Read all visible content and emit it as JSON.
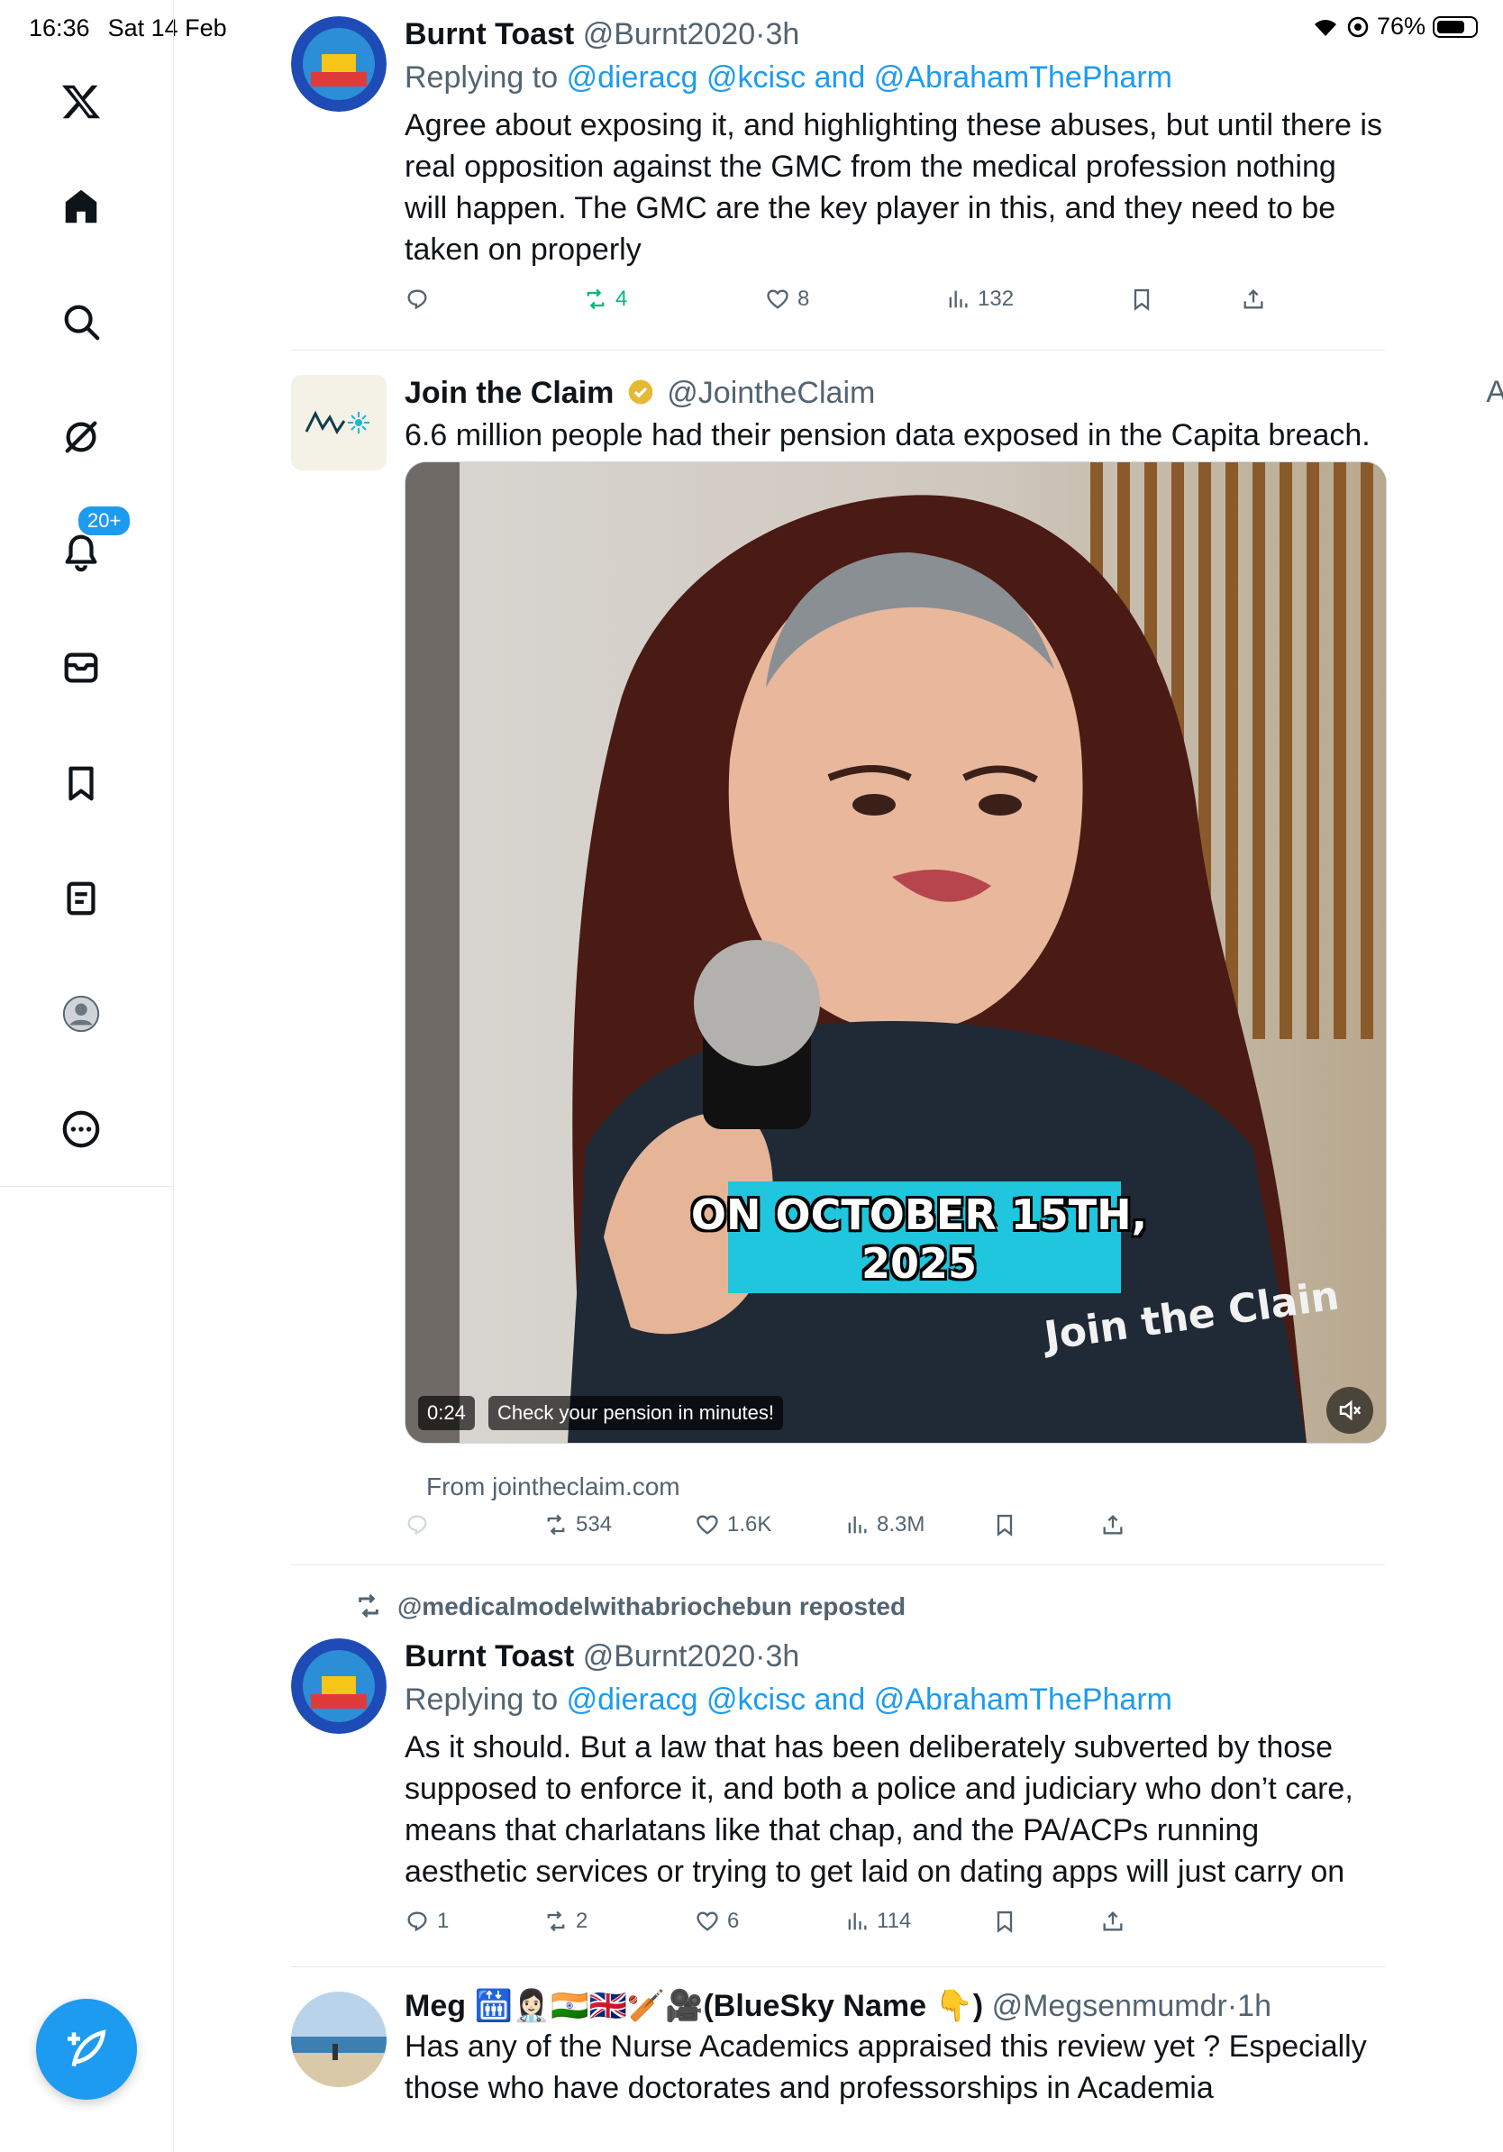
{
  "status_bar": {
    "time": "16:36",
    "date": "Sat 14 Feb",
    "battery": "76%",
    "battery_level": 0.76
  },
  "sidebar": {
    "items": [
      {
        "icon": "x-logo-icon"
      },
      {
        "icon": "home-icon"
      },
      {
        "icon": "search-icon"
      },
      {
        "icon": "grok-icon"
      },
      {
        "icon": "notifications-icon",
        "badge": "20+"
      },
      {
        "icon": "messages-icon"
      },
      {
        "icon": "bookmarks-icon"
      },
      {
        "icon": "lists-icon"
      },
      {
        "icon": "profile-icon"
      },
      {
        "icon": "more-icon"
      }
    ],
    "compose": {
      "icon": "compose-icon"
    }
  },
  "tweets": [
    {
      "name": "Burnt Toast",
      "handle": "@Burnt2020",
      "separator": "·",
      "time": "3h",
      "replying_prefix": "Replying to",
      "replying_to": [
        "@dieracg",
        "@kcisc"
      ],
      "replying_joiner": "and",
      "replying_last": "@AbrahamThePharm",
      "text": "Agree about exposing it, and highlighting these abuses, but until there is real opposition against the GMC from the medical profession nothing will happen. The GMC are the key player in this, and they need to be taken on properly",
      "stats": {
        "replies": "",
        "reposts": "4",
        "likes": "8",
        "views": "132"
      }
    },
    {
      "name": "Join the Claim",
      "handle": "@JointheClaim",
      "ad_label": "Ad",
      "more": "···",
      "text": "6.6 million people had their pension data exposed in the Capita breach.",
      "video": {
        "caption_overlay": "ON OCTOBER 15TH, 2025",
        "shirt_logo": "Join the Clain",
        "duration": "0:24",
        "caption": "Check your pension in minutes!"
      },
      "source": "From jointheclaim.com",
      "stats": {
        "replies": "",
        "reposts": "534",
        "likes": "1.6K",
        "views": "8.3M"
      }
    },
    {
      "reposted_by": "@medicalmodelwithabriochebun reposted",
      "name": "Burnt Toast",
      "handle": "@Burnt2020",
      "separator": "·",
      "time": "3h",
      "more": "···",
      "replying_prefix": "Replying to",
      "replying_to": [
        "@dieracg",
        "@kcisc"
      ],
      "replying_joiner": "and",
      "replying_last": "@AbrahamThePharm",
      "text": "As it should. But a law that has been deliberately subverted by those supposed to enforce it, and both a police and judiciary who don’t care, means that charlatans like that chap, and the PA/ACPs running aesthetic services or trying to get laid on dating apps will just carry on",
      "stats": {
        "replies": "1",
        "reposts": "2",
        "likes": "6",
        "views": "114"
      }
    },
    {
      "name": "Meg 🛗👩🏻‍⚕️🇮🇳🇬🇧🏏🎥(BlueSky Name 👇)",
      "handle": "@Megsenmumdr",
      "separator": "·",
      "time": "1h",
      "text": "Has any of the Nurse Academics appraised this review yet ? Especially those who have doctorates and professorships in Academia"
    }
  ],
  "colors": {
    "accent": "#1d9bf0",
    "repost_active": "#00ba7c",
    "secondary_text": "#536471",
    "caption_box": "#1fc6dd"
  }
}
